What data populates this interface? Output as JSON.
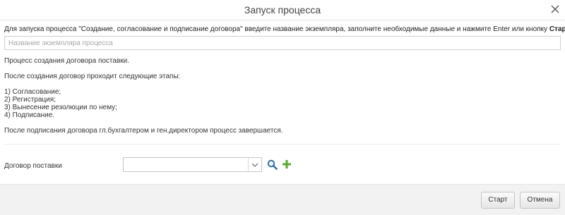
{
  "dialog": {
    "title": "Запуск процесса"
  },
  "prompt": {
    "text": "Для запуска процесса \"Создание, согласование и подписание договора\" введите название экземпляра, заполните необходимые данные и нажмите Enter или кнопку ",
    "start_word": "Старт",
    "period": "."
  },
  "instance_name": {
    "value": "",
    "placeholder": "Название экземпляра процесса"
  },
  "description": {
    "line1": "Процесс создания договора поставки.",
    "line2": "После создания договор проходит следующие этапы:",
    "steps": [
      "1) Согласование;",
      "2) Регистрация;",
      "3) Вынесение резолюции по нему;",
      "4) Подписание."
    ],
    "line3": "После подписания договора гл.бухгалтером и ген.директором процесс завершается."
  },
  "contract_field": {
    "label": "Договор поставки",
    "value": ""
  },
  "icons": {
    "close": "close-icon",
    "dropdown": "chevron-down-icon",
    "search": "search-icon",
    "add": "plus-icon"
  },
  "colors": {
    "search_icon": "#2d6fa8",
    "add_icon": "#5aa832"
  },
  "footer": {
    "start_label": "Старт",
    "cancel_label": "Отмена"
  }
}
